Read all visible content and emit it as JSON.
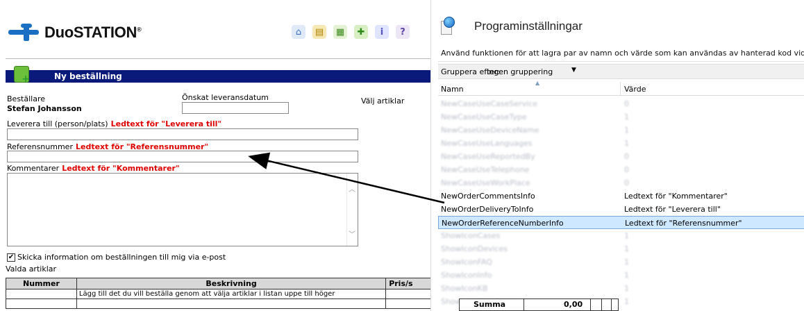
{
  "webform": {
    "logo_text": "DuoSTATION",
    "logo_reg": "®",
    "toolbar_icons": [
      "home-icon",
      "inbox-icon",
      "report-icon",
      "order-icon",
      "info-icon",
      "help-icon"
    ],
    "section_title": "Ny beställning",
    "bestallare_label": "Beställare",
    "bestallare_value": "Stefan Johansson",
    "leverans_label": "Önskat leveransdatum",
    "valj_artiklar": "Välj artiklar",
    "leverera_label": "Leverera till (person/plats)",
    "leverera_ledtext": "Ledtext för \"Leverera till\"",
    "referens_label": "Referensnummer",
    "referens_ledtext": "Ledtext för \"Referensnummer\"",
    "kommentarer_label": "Kommentarer",
    "kommentarer_ledtext": "Ledtext för \"Kommentarer\"",
    "email_checkbox_label": "Skicka information om beställningen till mig via e-post",
    "email_checked": true,
    "valda_artiklar": "Valda artiklar",
    "table": {
      "headers": [
        "Nummer",
        "Beskrivning",
        "Pris/s"
      ],
      "hint": "Lägg till det du vill beställa genom att välja artiklar i listan uppe till höger",
      "summa_label": "Summa",
      "summa_value": "0,00"
    }
  },
  "dialog": {
    "title": "Programinställningar",
    "description": "Använd funktionen för att lagra par av namn och värde som kan användas av hanterad kod vid körn",
    "group_label": "Gruppera efter:",
    "group_value": "Ingen gruppering",
    "col_name": "Namn",
    "col_value": "Värde",
    "rows": [
      {
        "name": "NewCaseUseCaseService",
        "value": "0",
        "blurred": true
      },
      {
        "name": "NewCaseUseCaseType",
        "value": "1",
        "blurred": true
      },
      {
        "name": "NewCaseUseDeviceName",
        "value": "1",
        "blurred": true
      },
      {
        "name": "NewCaseUseLanguages",
        "value": "1",
        "blurred": true
      },
      {
        "name": "NewCaseUseReportedBy",
        "value": "0",
        "blurred": true
      },
      {
        "name": "NewCaseUseTelephone",
        "value": "0",
        "blurred": true
      },
      {
        "name": "NewCaseUseWorkPlace",
        "value": "0",
        "blurred": true
      },
      {
        "name": "NewOrderCommentsInfo",
        "value": "Ledtext för \"Kommentarer\"",
        "blurred": false
      },
      {
        "name": "NewOrderDeliveryToInfo",
        "value": "Ledtext för \"Leverera till\"",
        "blurred": false
      },
      {
        "name": "NewOrderReferenceNumberInfo",
        "value": "Ledtext för \"Referensnummer\"",
        "blurred": false,
        "selected": true
      },
      {
        "name": "ShowIconCases",
        "value": "1",
        "blurred": true
      },
      {
        "name": "ShowIconDevices",
        "value": "1",
        "blurred": true
      },
      {
        "name": "ShowIconFAQ",
        "value": "1",
        "blurred": true
      },
      {
        "name": "ShowIconInfo",
        "value": "1",
        "blurred": true
      },
      {
        "name": "ShowIconKB",
        "value": "1",
        "blurred": true
      },
      {
        "name": "ShowIconNewCase",
        "value": "1",
        "blurred": true
      }
    ]
  },
  "colors": {
    "section_bar": "#0a1a7a",
    "ledtext_red": "#e00000",
    "selected_row": "#cde8ff"
  }
}
